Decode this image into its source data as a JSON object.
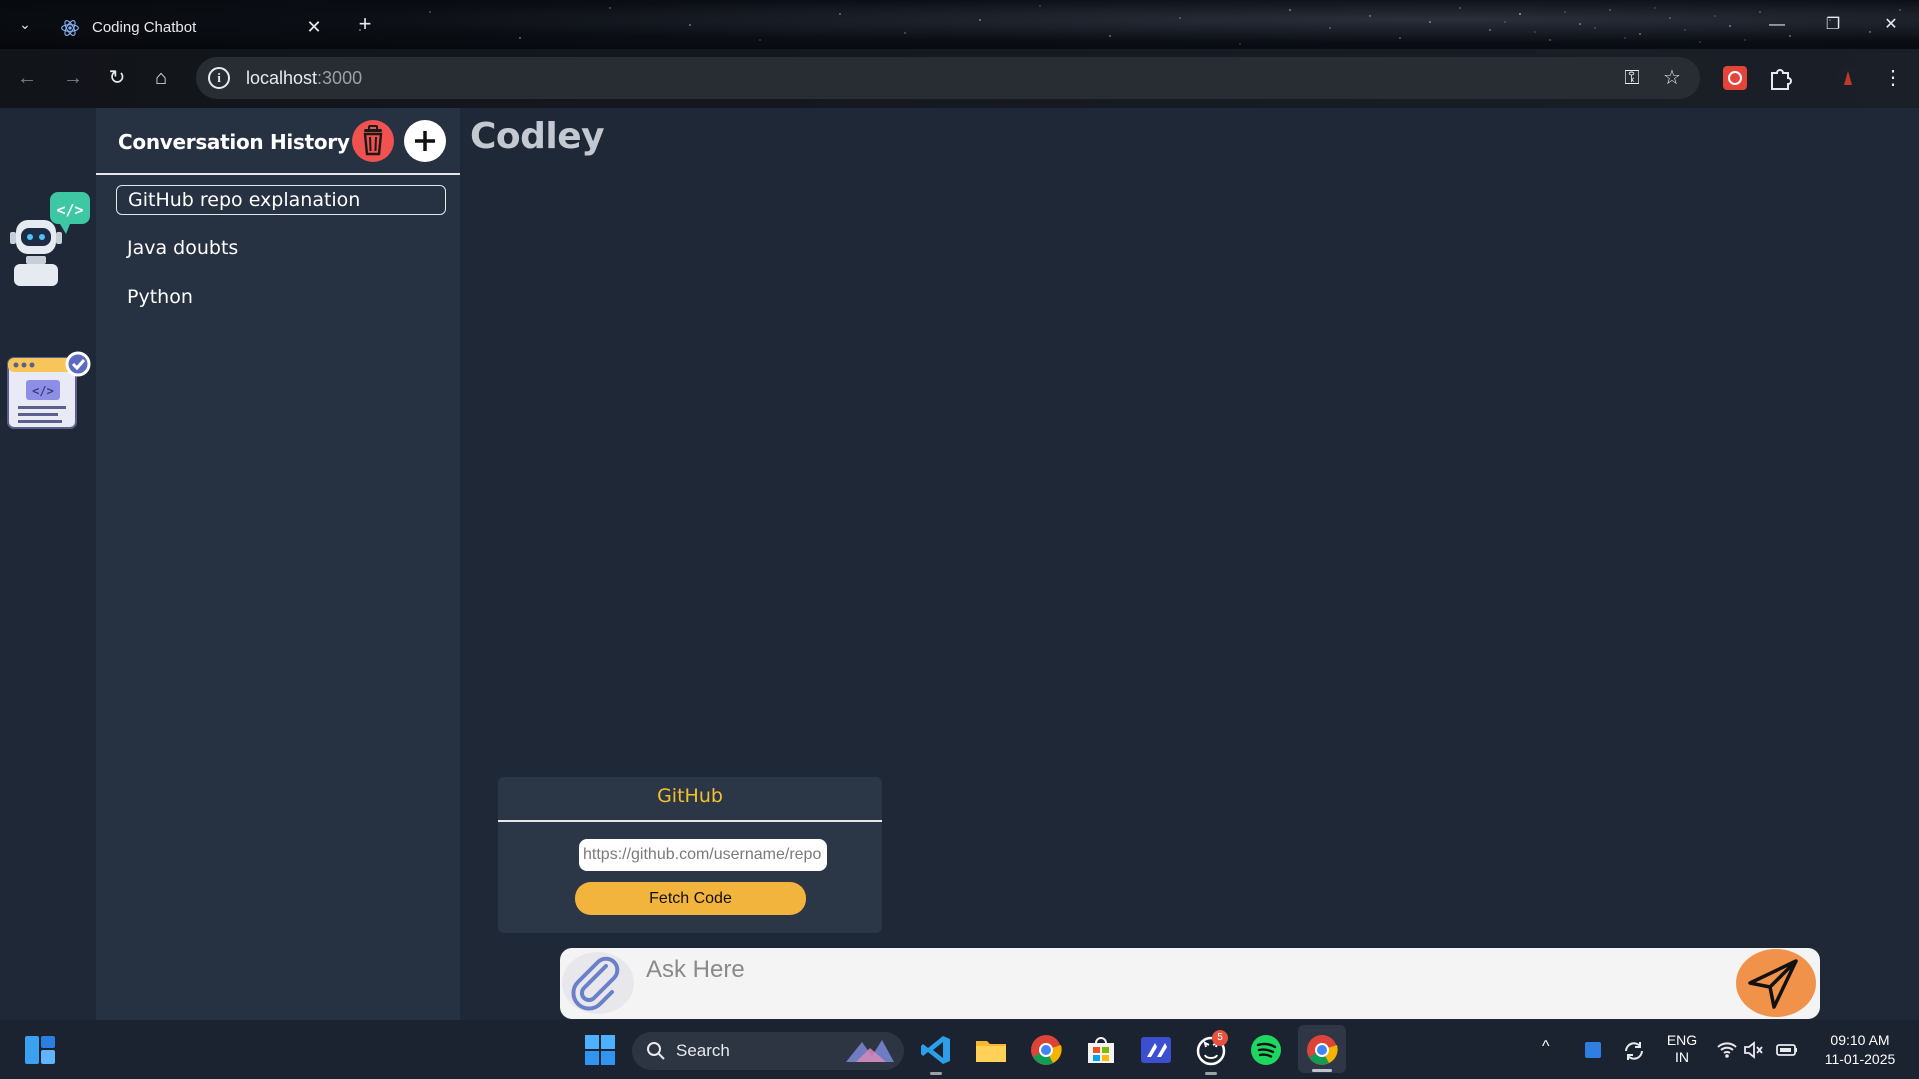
{
  "browser": {
    "tab_title": "Coding Chatbot",
    "url_host": "localhost",
    "url_port": ":3000",
    "icons": [
      "chevron-down-icon",
      "react-icon",
      "close-icon",
      "plus-icon",
      "minimize-icon",
      "restore-icon",
      "close-window-icon",
      "back-icon",
      "forward-icon",
      "reload-icon",
      "home-icon",
      "info-icon",
      "key-icon",
      "star-icon",
      "extension-icon",
      "puzzle-icon",
      "profile-icon",
      "menu-icon"
    ]
  },
  "sidebar": {
    "title": "Conversation History",
    "items": [
      {
        "label": "GitHub repo explanation",
        "active": true
      },
      {
        "label": "Java doubts",
        "active": false
      },
      {
        "label": "Python",
        "active": false
      }
    ]
  },
  "main": {
    "app_title": "Codley"
  },
  "github_panel": {
    "title": "GitHub",
    "input_placeholder": "https://github.com/username/repo",
    "button_label": "Fetch Code"
  },
  "ask": {
    "placeholder": "Ask Here"
  },
  "taskbar": {
    "search_label": "Search",
    "lang_top": "ENG",
    "lang_bottom": "IN",
    "time": "09:10 AM",
    "date": "11-01-2025",
    "github_badge": "5"
  },
  "colors": {
    "app_bg": "#1e2836",
    "sidebar_bg": "#263142",
    "accent_yellow": "#f5c030",
    "fetch_button": "#f2b43c",
    "trash": "#f0524f",
    "send": "#f0924a"
  }
}
